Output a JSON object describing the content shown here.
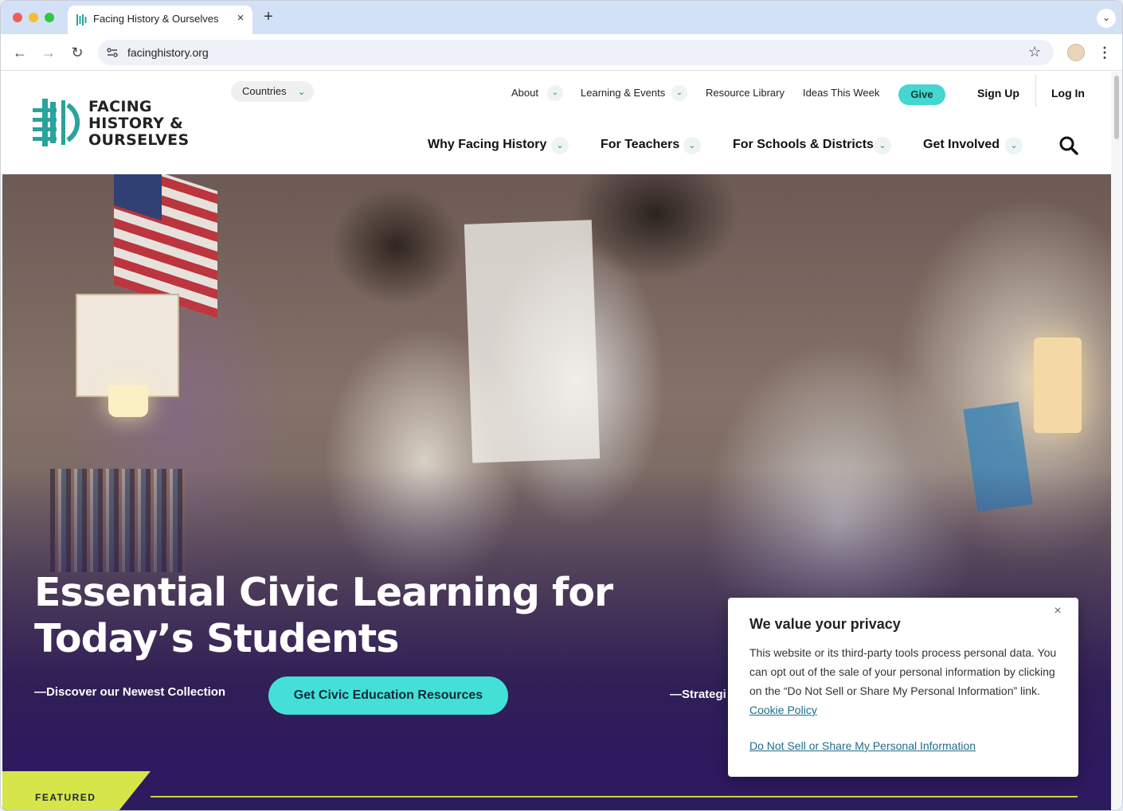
{
  "browser": {
    "tab_title": "Facing History & Ourselves",
    "tab_close": "×",
    "new_tab": "+",
    "url": "facinghistory.org"
  },
  "site": {
    "logo_lines": [
      "FACING",
      "HISTORY &",
      "OURSELVES"
    ],
    "countries_label": "Countries",
    "utility_nav": [
      {
        "label": "About",
        "has_dropdown": true
      },
      {
        "label": "Learning & Events",
        "has_dropdown": true
      },
      {
        "label": "Resource Library",
        "has_dropdown": false
      },
      {
        "label": "Ideas This Week",
        "has_dropdown": false
      }
    ],
    "give_label": "Give",
    "signup_label": "Sign Up",
    "login_label": "Log In",
    "main_nav": [
      {
        "label": "Why Facing History"
      },
      {
        "label": "For Teachers"
      },
      {
        "label": "For Schools & Districts"
      },
      {
        "label": "Get Involved"
      }
    ],
    "colors": {
      "teal": "#44d6cf",
      "brand_teal_dark": "#1a8e86",
      "hero_purple": "#2e1a5e",
      "featured_yellow": "#d6e64a"
    }
  },
  "hero": {
    "title": "Essential Civic Learning for Today’s Students",
    "discover_text": "—Discover our Newest Collection",
    "cta_label": "Get Civic Education Resources",
    "secondary_text": "—Strategi"
  },
  "featured": {
    "label": "FEATURED"
  },
  "privacy": {
    "title": "We value your privacy",
    "body": "This website or its third-party tools process personal data. You can opt out of the sale of your personal information by clicking on the “Do Not Sell or Share My Personal Information” link.",
    "cookie_policy_link": "Cookie Policy",
    "opt_out_link": "Do Not Sell or Share My Personal Information",
    "close": "×"
  }
}
